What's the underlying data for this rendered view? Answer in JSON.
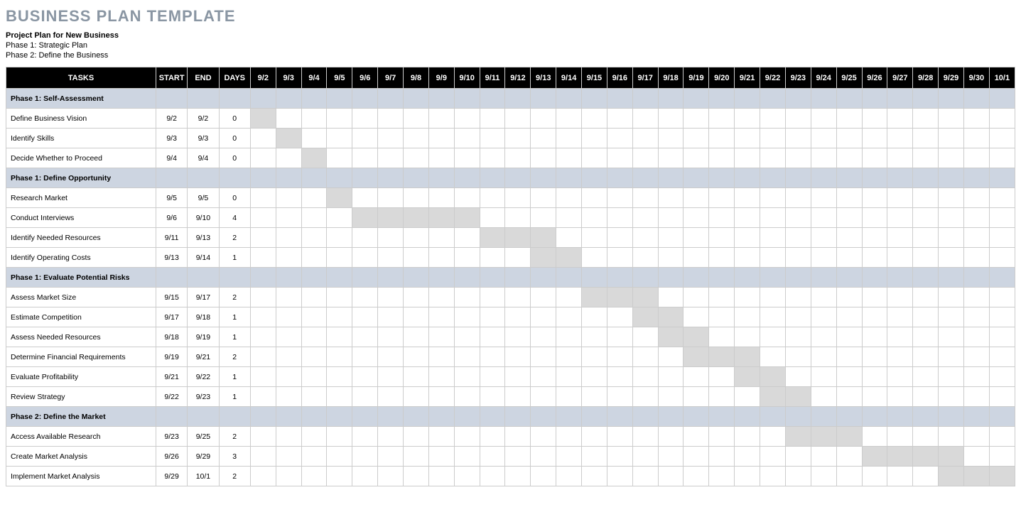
{
  "title": "BUSINESS PLAN TEMPLATE",
  "subtitle": "Project Plan for New Business",
  "phase_lines": [
    "Phase 1: Strategic Plan",
    "Phase 2: Define the Business"
  ],
  "headers": {
    "tasks": "TASKS",
    "start": "START",
    "end": "END",
    "days": "DAYS"
  },
  "dates": [
    "9/2",
    "9/3",
    "9/4",
    "9/5",
    "9/6",
    "9/7",
    "9/8",
    "9/9",
    "9/10",
    "9/11",
    "9/12",
    "9/13",
    "9/14",
    "9/15",
    "9/16",
    "9/17",
    "9/18",
    "9/19",
    "9/20",
    "9/21",
    "9/22",
    "9/23",
    "9/24",
    "9/25",
    "9/26",
    "9/27",
    "9/28",
    "9/29",
    "9/30",
    "10/1"
  ],
  "rows": [
    {
      "type": "phase",
      "label": "Phase 1: Self-Assessment"
    },
    {
      "type": "task",
      "label": "Define Business Vision",
      "start": "9/2",
      "end": "9/2",
      "days": "0",
      "bar_start": 0,
      "bar_len": 1
    },
    {
      "type": "task",
      "label": "Identify Skills",
      "start": "9/3",
      "end": "9/3",
      "days": "0",
      "bar_start": 1,
      "bar_len": 1
    },
    {
      "type": "task",
      "label": "Decide Whether to Proceed",
      "start": "9/4",
      "end": "9/4",
      "days": "0",
      "bar_start": 2,
      "bar_len": 1
    },
    {
      "type": "phase",
      "label": "Phase 1: Define Opportunity"
    },
    {
      "type": "task",
      "label": "Research Market",
      "start": "9/5",
      "end": "9/5",
      "days": "0",
      "bar_start": 3,
      "bar_len": 1
    },
    {
      "type": "task",
      "label": "Conduct Interviews",
      "start": "9/6",
      "end": "9/10",
      "days": "4",
      "bar_start": 4,
      "bar_len": 5
    },
    {
      "type": "task",
      "label": "Identify Needed Resources",
      "start": "9/11",
      "end": "9/13",
      "days": "2",
      "bar_start": 9,
      "bar_len": 3
    },
    {
      "type": "task",
      "label": "Identify Operating Costs",
      "start": "9/13",
      "end": "9/14",
      "days": "1",
      "bar_start": 11,
      "bar_len": 2
    },
    {
      "type": "phase",
      "label": "Phase 1: Evaluate Potential Risks"
    },
    {
      "type": "task",
      "label": "Assess Market Size",
      "start": "9/15",
      "end": "9/17",
      "days": "2",
      "bar_start": 13,
      "bar_len": 3
    },
    {
      "type": "task",
      "label": "Estimate Competition",
      "start": "9/17",
      "end": "9/18",
      "days": "1",
      "bar_start": 15,
      "bar_len": 2
    },
    {
      "type": "task",
      "label": "Assess Needed Resources",
      "start": "9/18",
      "end": "9/19",
      "days": "1",
      "bar_start": 16,
      "bar_len": 2
    },
    {
      "type": "task",
      "label": "Determine Financial Requirements",
      "start": "9/19",
      "end": "9/21",
      "days": "2",
      "bar_start": 17,
      "bar_len": 3
    },
    {
      "type": "task",
      "label": "Evaluate Profitability",
      "start": "9/21",
      "end": "9/22",
      "days": "1",
      "bar_start": 19,
      "bar_len": 2
    },
    {
      "type": "task",
      "label": "Review Strategy",
      "start": "9/22",
      "end": "9/23",
      "days": "1",
      "bar_start": 20,
      "bar_len": 2
    },
    {
      "type": "phase",
      "label": "Phase 2: Define the Market"
    },
    {
      "type": "task",
      "label": "Access Available Research",
      "start": "9/23",
      "end": "9/25",
      "days": "2",
      "bar_start": 21,
      "bar_len": 3
    },
    {
      "type": "task",
      "label": "Create Market Analysis",
      "start": "9/26",
      "end": "9/29",
      "days": "3",
      "bar_start": 24,
      "bar_len": 4
    },
    {
      "type": "task",
      "label": "Implement Market Analysis",
      "start": "9/29",
      "end": "10/1",
      "days": "2",
      "bar_start": 27,
      "bar_len": 3
    }
  ],
  "chart_data": {
    "type": "table",
    "title": "Business Plan Gantt",
    "x": [
      "9/2",
      "9/3",
      "9/4",
      "9/5",
      "9/6",
      "9/7",
      "9/8",
      "9/9",
      "9/10",
      "9/11",
      "9/12",
      "9/13",
      "9/14",
      "9/15",
      "9/16",
      "9/17",
      "9/18",
      "9/19",
      "9/20",
      "9/21",
      "9/22",
      "9/23",
      "9/24",
      "9/25",
      "9/26",
      "9/27",
      "9/28",
      "9/29",
      "9/30",
      "10/1"
    ],
    "series": [
      {
        "name": "Define Business Vision",
        "start": "9/2",
        "end": "9/2",
        "days": 0
      },
      {
        "name": "Identify Skills",
        "start": "9/3",
        "end": "9/3",
        "days": 0
      },
      {
        "name": "Decide Whether to Proceed",
        "start": "9/4",
        "end": "9/4",
        "days": 0
      },
      {
        "name": "Research Market",
        "start": "9/5",
        "end": "9/5",
        "days": 0
      },
      {
        "name": "Conduct Interviews",
        "start": "9/6",
        "end": "9/10",
        "days": 4
      },
      {
        "name": "Identify Needed Resources",
        "start": "9/11",
        "end": "9/13",
        "days": 2
      },
      {
        "name": "Identify Operating Costs",
        "start": "9/13",
        "end": "9/14",
        "days": 1
      },
      {
        "name": "Assess Market Size",
        "start": "9/15",
        "end": "9/17",
        "days": 2
      },
      {
        "name": "Estimate Competition",
        "start": "9/17",
        "end": "9/18",
        "days": 1
      },
      {
        "name": "Assess Needed Resources",
        "start": "9/18",
        "end": "9/19",
        "days": 1
      },
      {
        "name": "Determine Financial Requirements",
        "start": "9/19",
        "end": "9/21",
        "days": 2
      },
      {
        "name": "Evaluate Profitability",
        "start": "9/21",
        "end": "9/22",
        "days": 1
      },
      {
        "name": "Review Strategy",
        "start": "9/22",
        "end": "9/23",
        "days": 1
      },
      {
        "name": "Access Available Research",
        "start": "9/23",
        "end": "9/25",
        "days": 2
      },
      {
        "name": "Create Market Analysis",
        "start": "9/26",
        "end": "9/29",
        "days": 3
      },
      {
        "name": "Implement Market Analysis",
        "start": "9/29",
        "end": "10/1",
        "days": 2
      }
    ]
  }
}
